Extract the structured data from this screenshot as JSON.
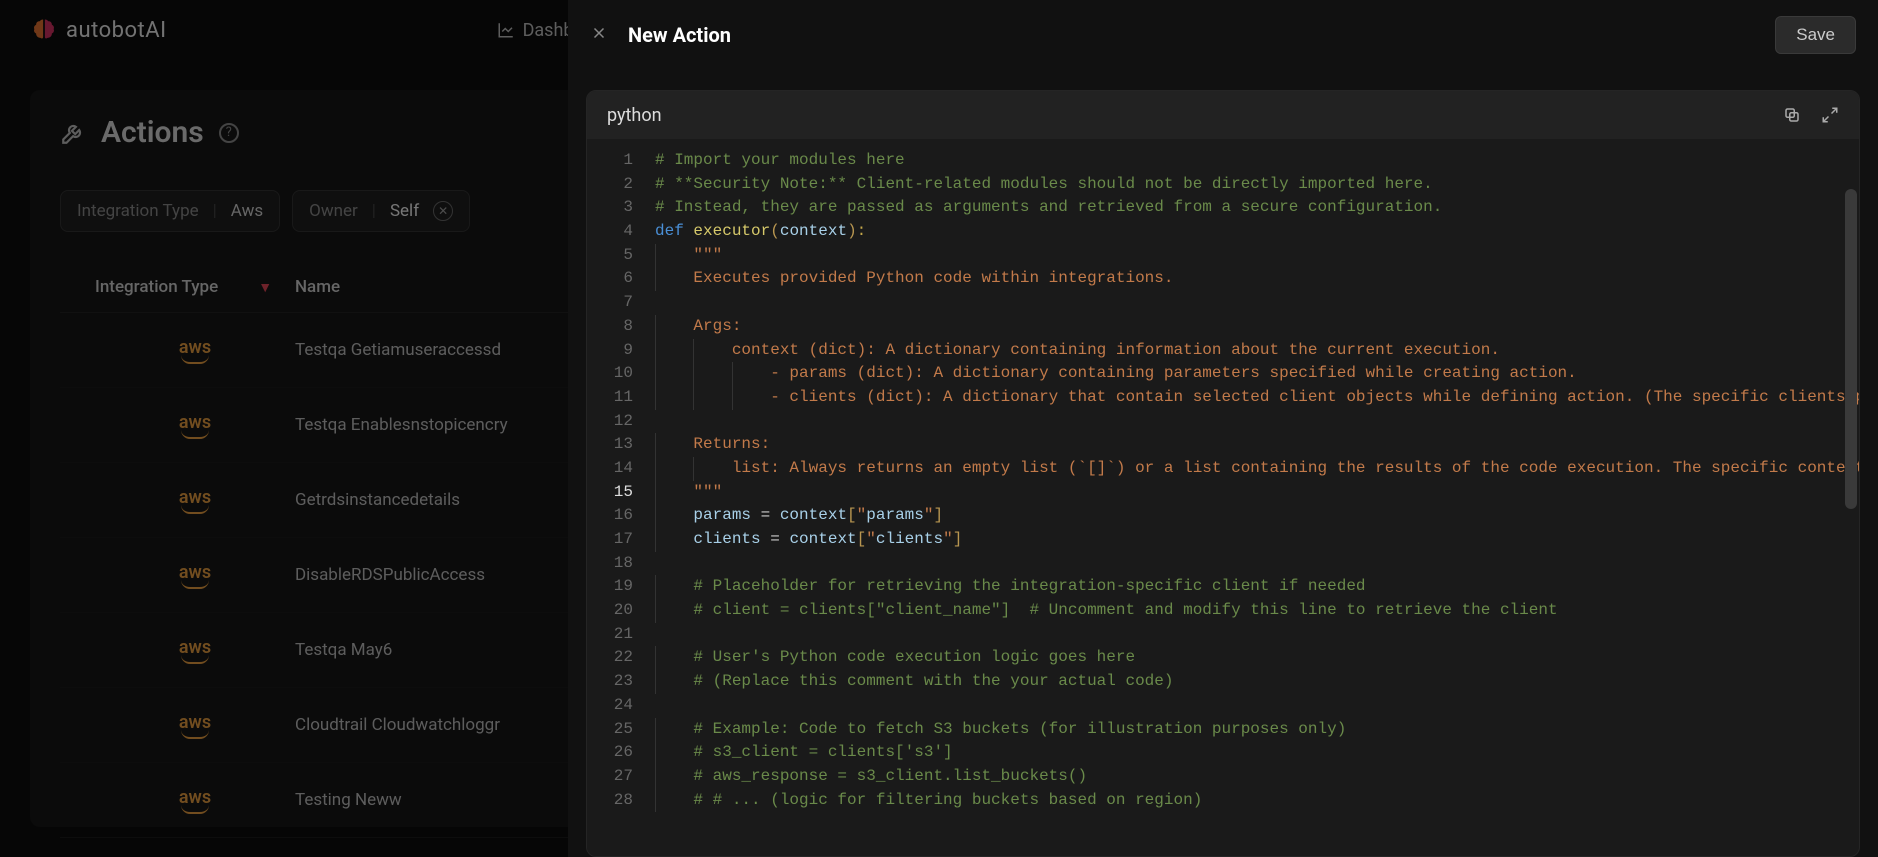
{
  "brand": "autobotAI",
  "nav": {
    "dashboards": "Dashboards"
  },
  "page": {
    "title": "Actions",
    "filters": {
      "integration_label": "Integration Type",
      "integration_value": "Aws",
      "owner_label": "Owner",
      "owner_value": "Self"
    },
    "columns": {
      "col1": "Integration Type",
      "col2": "Name"
    },
    "rows": [
      {
        "integration": "aws",
        "name": "Testqa Getiamuseraccessd"
      },
      {
        "integration": "aws",
        "name": "Testqa Enablesnstopicencry"
      },
      {
        "integration": "aws",
        "name": "Getrdsinstancedetails"
      },
      {
        "integration": "aws",
        "name": "DisableRDSPublicAccess"
      },
      {
        "integration": "aws",
        "name": "Testqa May6"
      },
      {
        "integration": "aws",
        "name": "Cloudtrail Cloudwatchloggr"
      },
      {
        "integration": "aws",
        "name": "Testing Neww"
      }
    ]
  },
  "drawer": {
    "title": "New Action",
    "save": "Save",
    "language": "python"
  },
  "code": {
    "active_line": 15,
    "lines": [
      "# Import your modules here",
      "# **Security Note:** Client-related modules should not be directly imported here.",
      "# Instead, they are passed as arguments and retrieved from a secure configuration.",
      "def executor(context):",
      "    \"\"\"",
      "    Executes provided Python code within integrations.",
      "",
      "    Args:",
      "        context (dict): A dictionary containing information about the current execution.",
      "            - params (dict): A dictionary containing parameters specified while creating action.",
      "            - clients (dict): A dictionary that contain selected client objects while defining action. (The specific clients present and their usage depend on the specific action being executed.)",
      "",
      "    Returns:",
      "        list: Always returns an empty list (`[]`) or a list containing the results of the code execution. The specific content of the returned list depends on the code and how it interacts with the integration.",
      "    \"\"\"",
      "    params = context[\"params\"]",
      "    clients = context[\"clients\"]",
      "",
      "    # Placeholder for retrieving the integration-specific client if needed",
      "    # client = clients[\"client_name\"]  # Uncomment and modify this line to retrieve the client",
      "",
      "    # User's Python code execution logic goes here",
      "    # (Replace this comment with the your actual code)",
      "",
      "    # Example: Code to fetch S3 buckets (for illustration purposes only)",
      "    # s3_client = clients['s3']",
      "    # aws_response = s3_client.list_buckets()",
      "    # # ... (logic for filtering buckets based on region)"
    ]
  }
}
